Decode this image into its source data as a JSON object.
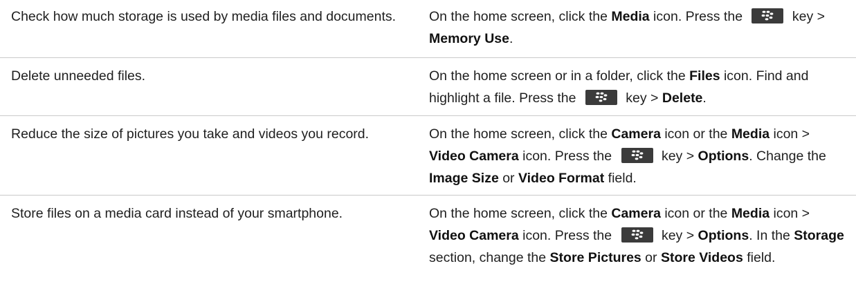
{
  "menu_key_icon": "blackberry-menu-key-icon",
  "rows": [
    {
      "action": "Check how much storage is used by media files and documents.",
      "steps": {
        "t1": "On the home screen, click the ",
        "b1": "Media",
        "t2": " icon. Press the ",
        "t3": " key > ",
        "b2": "Memory Use",
        "t4": "."
      }
    },
    {
      "action": "Delete unneeded files.",
      "steps": {
        "t1": "On the home screen or in a folder, click the ",
        "b1": "Files",
        "t2": " icon. Find and highlight a file. Press the ",
        "t3": " key > ",
        "b2": "Delete",
        "t4": "."
      }
    },
    {
      "action": "Reduce the size of pictures you take and videos you record.",
      "steps": {
        "t1": "On the home screen, click the ",
        "b1": "Camera",
        "t2": " icon or the ",
        "b2": "Media",
        "t3": " icon > ",
        "b3": "Video Camera",
        "t4": " icon. Press the ",
        "t5": " key > ",
        "b4": "Options",
        "t6": ". Change the ",
        "b5": "Image Size",
        "t7": " or ",
        "b6": "Video Format",
        "t8": " field."
      }
    },
    {
      "action": "Store files on a media card instead of your smartphone.",
      "steps": {
        "t1": "On the home screen, click the ",
        "b1": "Camera",
        "t2": " icon or the ",
        "b2": "Media",
        "t3": " icon > ",
        "b3": "Video Camera",
        "t4": " icon. Press the ",
        "t5": " key > ",
        "b4": "Options",
        "t6": ". In the ",
        "b5": "Storage",
        "t7": " section, change the ",
        "b6": "Store Pictures",
        "t8": " or ",
        "b7": "Store Videos",
        "t9": " field."
      }
    }
  ]
}
